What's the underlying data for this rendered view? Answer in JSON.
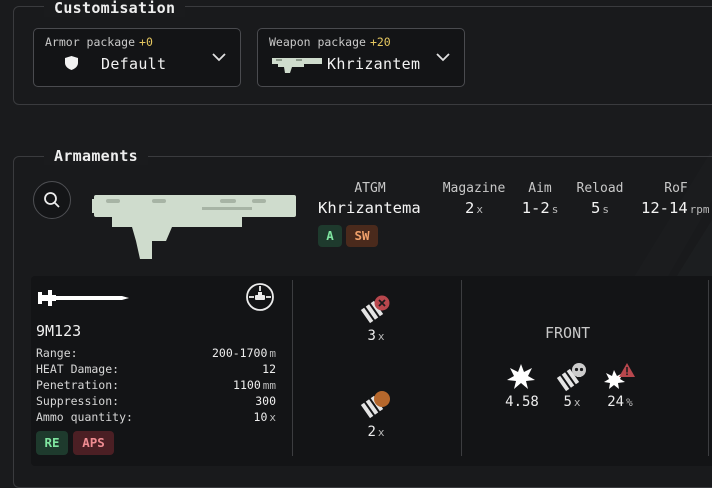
{
  "customisation": {
    "title": "Customisation",
    "armor": {
      "label": "Armor package",
      "bonus": "+0",
      "value": "Default"
    },
    "weapon": {
      "label": "Weapon package",
      "bonus": "+20",
      "value": "Khrizantem"
    }
  },
  "armaments": {
    "title": "Armaments",
    "weapon_type": "ATGM",
    "weapon_name": "Khrizantema",
    "stats": {
      "magazine": {
        "label": "Magazine",
        "value": "2",
        "unit": "x"
      },
      "aim": {
        "label": "Aim",
        "value": "1-2",
        "unit": "s"
      },
      "reload": {
        "label": "Reload",
        "value": "5",
        "unit": "s"
      },
      "rof": {
        "label": "RoF",
        "value": "12-14",
        "unit": "rpm"
      }
    },
    "tags": [
      "A",
      "SW"
    ],
    "ammo": {
      "name": "9M123",
      "rows": [
        {
          "label": "Range:",
          "value": "200-1700",
          "unit": "m"
        },
        {
          "label": "HEAT Damage:",
          "value": "12",
          "unit": ""
        },
        {
          "label": "Penetration:",
          "value": "1100",
          "unit": "mm"
        },
        {
          "label": "Suppression:",
          "value": "300",
          "unit": ""
        },
        {
          "label": "Ammo quantity:",
          "value": "10",
          "unit": "x"
        }
      ],
      "tags": [
        "RE",
        "APS"
      ],
      "counts": [
        {
          "value": "3",
          "unit": "x"
        },
        {
          "value": "2",
          "unit": "x"
        }
      ]
    },
    "front": {
      "label": "FRONT",
      "values": [
        {
          "value": "4.58",
          "unit": ""
        },
        {
          "value": "5",
          "unit": "x"
        },
        {
          "value": "24",
          "unit": "%"
        }
      ]
    }
  },
  "colors": {
    "accent": "#e6c860",
    "green": "#7fe6a0",
    "orange": "#f0a06a",
    "red": "#f08c92",
    "weapon": "#cfdccd"
  }
}
